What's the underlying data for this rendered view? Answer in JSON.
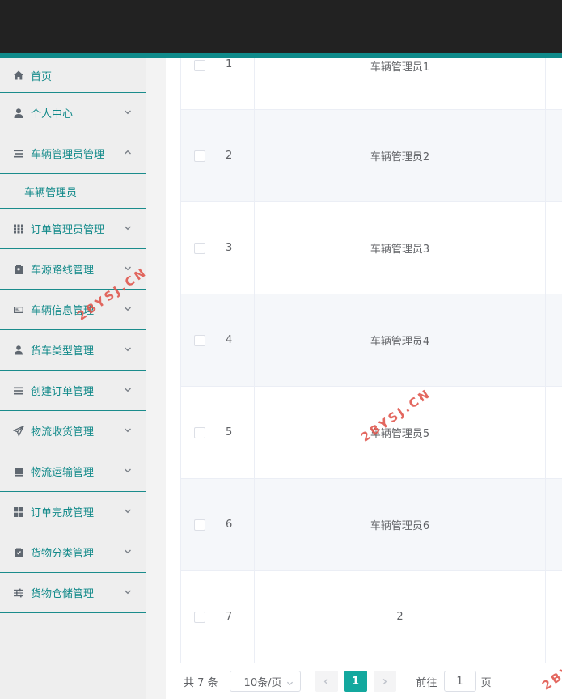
{
  "sidebar": {
    "items": [
      {
        "label": "首页",
        "icon": "home-icon"
      },
      {
        "label": "个人中心",
        "icon": "user-icon"
      },
      {
        "label": "车辆管理员管理",
        "icon": "menu-icon",
        "sub": "车辆管理员"
      },
      {
        "label": "订单管理员管理",
        "icon": "grid-icon"
      },
      {
        "label": "车源路线管理",
        "icon": "clipboard-x-icon"
      },
      {
        "label": "车辆信息管理",
        "icon": "id-card-icon"
      },
      {
        "label": "货车类型管理",
        "icon": "person-icon"
      },
      {
        "label": "创建订单管理",
        "icon": "list-icon"
      },
      {
        "label": "物流收货管理",
        "icon": "send-icon"
      },
      {
        "label": "物流运输管理",
        "icon": "box-icon"
      },
      {
        "label": "订单完成管理",
        "icon": "blocks-icon"
      },
      {
        "label": "货物分类管理",
        "icon": "clipboard-check-icon"
      },
      {
        "label": "货物仓储管理",
        "icon": "sliders-icon"
      }
    ]
  },
  "table": {
    "rows": [
      {
        "index": "1",
        "name": "车辆管理员1"
      },
      {
        "index": "2",
        "name": "车辆管理员2"
      },
      {
        "index": "3",
        "name": "车辆管理员3"
      },
      {
        "index": "4",
        "name": "车辆管理员4"
      },
      {
        "index": "5",
        "name": "车辆管理员5"
      },
      {
        "index": "6",
        "name": "车辆管理员6"
      },
      {
        "index": "7",
        "name": "2"
      }
    ]
  },
  "pager": {
    "total": "共 7 条",
    "page_size": "10条/页",
    "current_page": "1",
    "goto_label": "前往",
    "goto_value": "1",
    "page_suffix": "页"
  },
  "watermark": "2BYSJ.CN",
  "colors": {
    "accent": "#13a89e",
    "sidebar_text": "#138a8a",
    "topbar": "#222222",
    "watermark": "#e0584f"
  }
}
